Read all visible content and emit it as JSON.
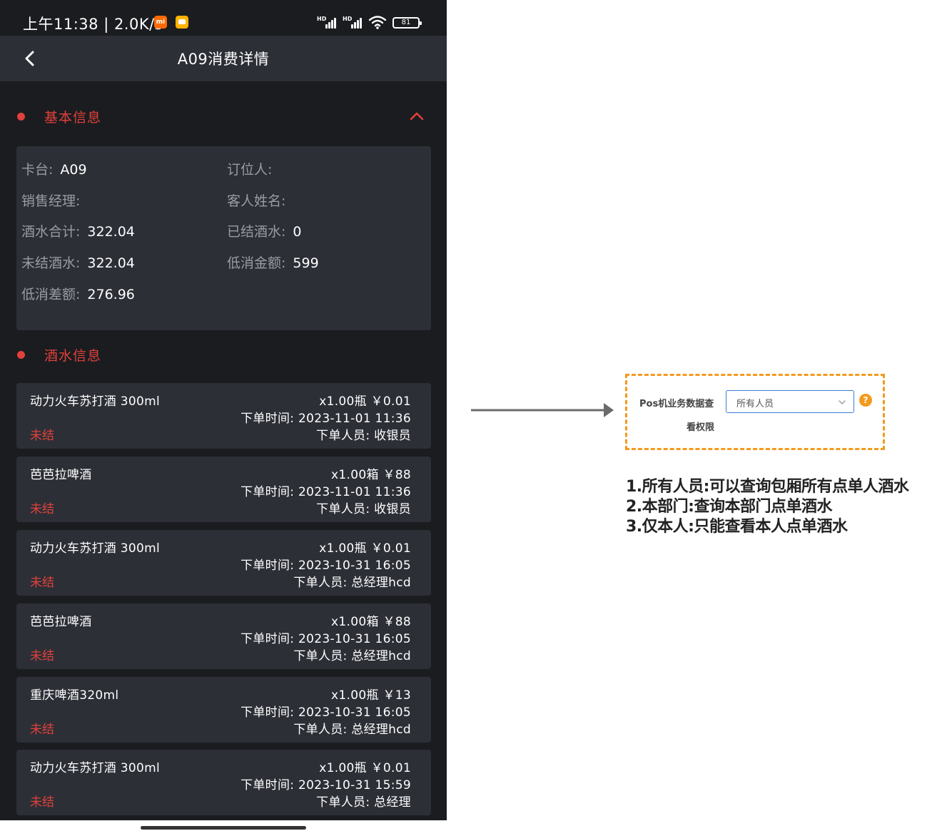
{
  "status_bar": {
    "time": "上午11:38 | 2.0K/s",
    "mi_badge": "mi",
    "signal_tag": "HD",
    "battery": "81"
  },
  "nav": {
    "title": "A09消费详情"
  },
  "basic_info": {
    "title": "基本信息",
    "fields": [
      {
        "label": "卡台:",
        "value": "A09"
      },
      {
        "label": "订位人:",
        "value": ""
      },
      {
        "label": "销售经理:",
        "value": ""
      },
      {
        "label": "客人姓名:",
        "value": ""
      },
      {
        "label": "酒水合计:",
        "value": "322.04"
      },
      {
        "label": "已结酒水:",
        "value": "0"
      },
      {
        "label": "未结酒水:",
        "value": "322.04"
      },
      {
        "label": "低消金额:",
        "value": "599"
      },
      {
        "label": "低消差额:",
        "value": "276.96"
      }
    ]
  },
  "drinks": {
    "title": "酒水信息",
    "items": [
      {
        "name": "动力火车苏打酒 300ml",
        "qty": "x1.00瓶 ￥0.01",
        "time": "下单时间: 2023-11-01 11:36",
        "operator": "下单人员: 收银员",
        "status": "未结"
      },
      {
        "name": "芭芭拉啤酒",
        "qty": "x1.00箱 ￥88",
        "time": "下单时间: 2023-11-01 11:36",
        "operator": "下单人员: 收银员",
        "status": "未结"
      },
      {
        "name": "动力火车苏打酒 300ml",
        "qty": "x1.00瓶 ￥0.01",
        "time": "下单时间: 2023-10-31 16:05",
        "operator": "下单人员: 总经理hcd",
        "status": "未结"
      },
      {
        "name": "芭芭拉啤酒",
        "qty": "x1.00箱 ￥88",
        "time": "下单时间: 2023-10-31 16:05",
        "operator": "下单人员: 总经理hcd",
        "status": "未结"
      },
      {
        "name": "重庆啤酒320ml",
        "qty": "x1.00瓶 ￥13",
        "time": "下单时间: 2023-10-31 16:05",
        "operator": "下单人员: 总经理hcd",
        "status": "未结"
      },
      {
        "name": "动力火车苏打酒 300ml",
        "qty": "x1.00瓶 ￥0.01",
        "time": "下单时间: 2023-10-31 15:59",
        "operator": "下单人员: 总经理",
        "status": "未结"
      }
    ]
  },
  "settings": {
    "label_line1": "Pos机业务数据查",
    "label_line2": "看权限",
    "select_value": "所有人员",
    "help": "?"
  },
  "notes": [
    "1.所有人员:可以查询包厢所有点单人酒水",
    "2.本部门:查询本部门点单酒水",
    "3.仅本人:只能查看本人点单酒水"
  ],
  "colors": {
    "accent_red": "#e0413a",
    "callout_orange": "#f39a1e",
    "card_bg": "#2d2f37",
    "page_bg": "#1b1c20",
    "select_border": "#3a7bd5"
  }
}
